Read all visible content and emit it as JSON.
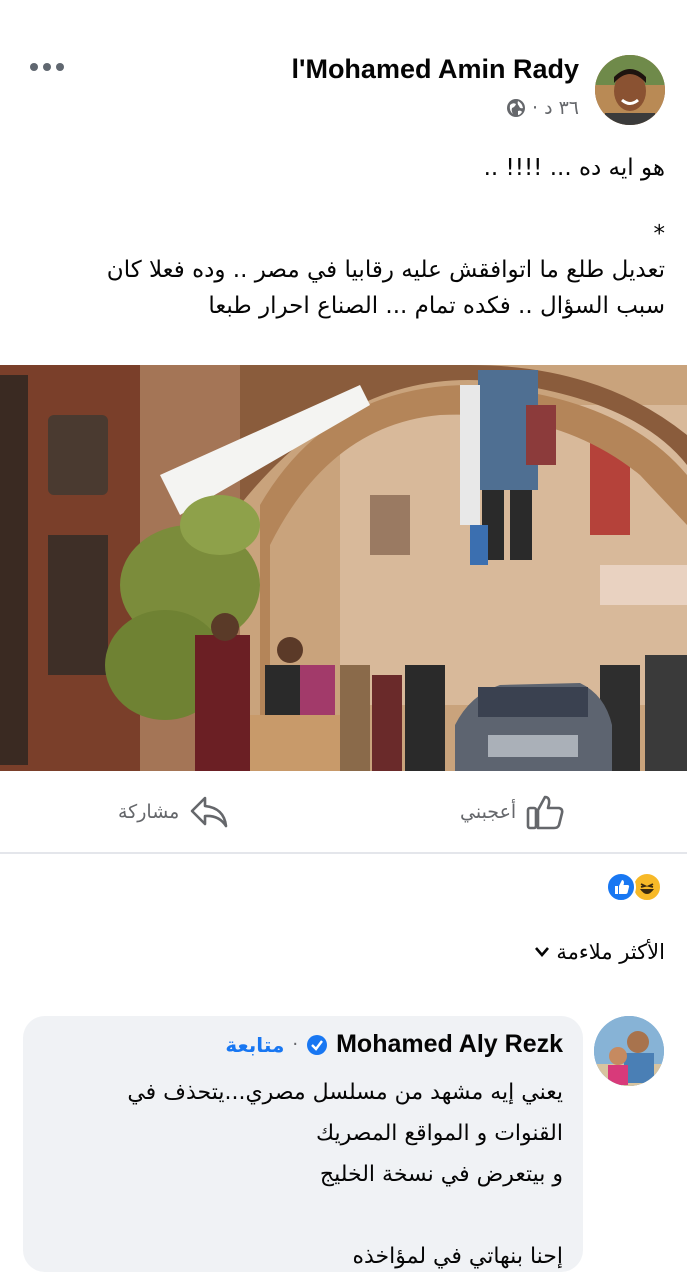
{
  "post": {
    "author": "l'Mohamed Amin Rady",
    "time": "٣٦ د",
    "text_lines": [
      "هو ايه ده ... !!!! ..",
      "*",
      "تعديل طلع ما  اتوافقش عليه رقابيا في مصر .. وده فعلا كان",
      "سبب السؤال .. فكده تمام ... الصناع احرار طبعا"
    ]
  },
  "actions": {
    "like_label": "أعجبني",
    "share_label": "مشاركة"
  },
  "reactions": [
    "like-icon",
    "haha-icon"
  ],
  "comments": {
    "sort_label": "الأكثر ملاءمة",
    "first": {
      "author": "Mohamed Aly Rezk",
      "follow_label": "متابعة",
      "lines": [
        "يعني إيه مشهد من مسلسل مصري...يتحذف في",
        "القنوات و المواقع المصريك",
        "و بيتعرض في نسخة الخليج",
        "إحنا بنهاتي في لمؤاخذه"
      ]
    }
  },
  "colors": {
    "accent": "#1877f2",
    "secondary_text": "#65676b",
    "comment_bg": "#f0f2f5"
  }
}
